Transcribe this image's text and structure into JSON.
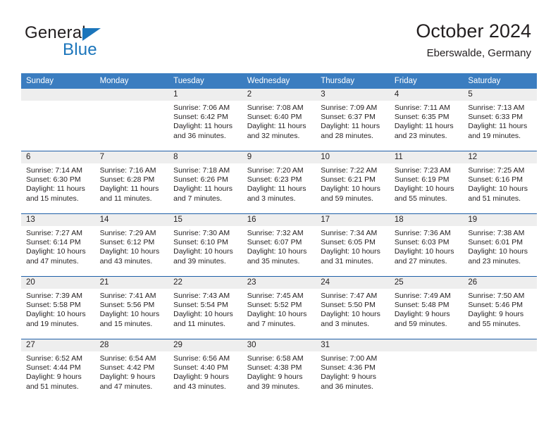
{
  "brand": {
    "word1": "General",
    "word2": "Blue",
    "logo_icon": "triangle-logo",
    "accent_color": "#1b75bb"
  },
  "header": {
    "title": "October 2024",
    "location": "Eberswalde, Germany"
  },
  "theme": {
    "header_blue": "#3b7dc0",
    "row_line_blue": "#1f5fa8",
    "daynum_band": "#eeeeee"
  },
  "calendar": {
    "weekday_headers": [
      "Sunday",
      "Monday",
      "Tuesday",
      "Wednesday",
      "Thursday",
      "Friday",
      "Saturday"
    ],
    "weeks": [
      [
        {
          "day": "",
          "sunrise": "",
          "sunset": "",
          "daylight1": "",
          "daylight2": ""
        },
        {
          "day": "",
          "sunrise": "",
          "sunset": "",
          "daylight1": "",
          "daylight2": ""
        },
        {
          "day": "1",
          "sunrise": "Sunrise: 7:06 AM",
          "sunset": "Sunset: 6:42 PM",
          "daylight1": "Daylight: 11 hours",
          "daylight2": "and 36 minutes."
        },
        {
          "day": "2",
          "sunrise": "Sunrise: 7:08 AM",
          "sunset": "Sunset: 6:40 PM",
          "daylight1": "Daylight: 11 hours",
          "daylight2": "and 32 minutes."
        },
        {
          "day": "3",
          "sunrise": "Sunrise: 7:09 AM",
          "sunset": "Sunset: 6:37 PM",
          "daylight1": "Daylight: 11 hours",
          "daylight2": "and 28 minutes."
        },
        {
          "day": "4",
          "sunrise": "Sunrise: 7:11 AM",
          "sunset": "Sunset: 6:35 PM",
          "daylight1": "Daylight: 11 hours",
          "daylight2": "and 23 minutes."
        },
        {
          "day": "5",
          "sunrise": "Sunrise: 7:13 AM",
          "sunset": "Sunset: 6:33 PM",
          "daylight1": "Daylight: 11 hours",
          "daylight2": "and 19 minutes."
        }
      ],
      [
        {
          "day": "6",
          "sunrise": "Sunrise: 7:14 AM",
          "sunset": "Sunset: 6:30 PM",
          "daylight1": "Daylight: 11 hours",
          "daylight2": "and 15 minutes."
        },
        {
          "day": "7",
          "sunrise": "Sunrise: 7:16 AM",
          "sunset": "Sunset: 6:28 PM",
          "daylight1": "Daylight: 11 hours",
          "daylight2": "and 11 minutes."
        },
        {
          "day": "8",
          "sunrise": "Sunrise: 7:18 AM",
          "sunset": "Sunset: 6:26 PM",
          "daylight1": "Daylight: 11 hours",
          "daylight2": "and 7 minutes."
        },
        {
          "day": "9",
          "sunrise": "Sunrise: 7:20 AM",
          "sunset": "Sunset: 6:23 PM",
          "daylight1": "Daylight: 11 hours",
          "daylight2": "and 3 minutes."
        },
        {
          "day": "10",
          "sunrise": "Sunrise: 7:22 AM",
          "sunset": "Sunset: 6:21 PM",
          "daylight1": "Daylight: 10 hours",
          "daylight2": "and 59 minutes."
        },
        {
          "day": "11",
          "sunrise": "Sunrise: 7:23 AM",
          "sunset": "Sunset: 6:19 PM",
          "daylight1": "Daylight: 10 hours",
          "daylight2": "and 55 minutes."
        },
        {
          "day": "12",
          "sunrise": "Sunrise: 7:25 AM",
          "sunset": "Sunset: 6:16 PM",
          "daylight1": "Daylight: 10 hours",
          "daylight2": "and 51 minutes."
        }
      ],
      [
        {
          "day": "13",
          "sunrise": "Sunrise: 7:27 AM",
          "sunset": "Sunset: 6:14 PM",
          "daylight1": "Daylight: 10 hours",
          "daylight2": "and 47 minutes."
        },
        {
          "day": "14",
          "sunrise": "Sunrise: 7:29 AM",
          "sunset": "Sunset: 6:12 PM",
          "daylight1": "Daylight: 10 hours",
          "daylight2": "and 43 minutes."
        },
        {
          "day": "15",
          "sunrise": "Sunrise: 7:30 AM",
          "sunset": "Sunset: 6:10 PM",
          "daylight1": "Daylight: 10 hours",
          "daylight2": "and 39 minutes."
        },
        {
          "day": "16",
          "sunrise": "Sunrise: 7:32 AM",
          "sunset": "Sunset: 6:07 PM",
          "daylight1": "Daylight: 10 hours",
          "daylight2": "and 35 minutes."
        },
        {
          "day": "17",
          "sunrise": "Sunrise: 7:34 AM",
          "sunset": "Sunset: 6:05 PM",
          "daylight1": "Daylight: 10 hours",
          "daylight2": "and 31 minutes."
        },
        {
          "day": "18",
          "sunrise": "Sunrise: 7:36 AM",
          "sunset": "Sunset: 6:03 PM",
          "daylight1": "Daylight: 10 hours",
          "daylight2": "and 27 minutes."
        },
        {
          "day": "19",
          "sunrise": "Sunrise: 7:38 AM",
          "sunset": "Sunset: 6:01 PM",
          "daylight1": "Daylight: 10 hours",
          "daylight2": "and 23 minutes."
        }
      ],
      [
        {
          "day": "20",
          "sunrise": "Sunrise: 7:39 AM",
          "sunset": "Sunset: 5:58 PM",
          "daylight1": "Daylight: 10 hours",
          "daylight2": "and 19 minutes."
        },
        {
          "day": "21",
          "sunrise": "Sunrise: 7:41 AM",
          "sunset": "Sunset: 5:56 PM",
          "daylight1": "Daylight: 10 hours",
          "daylight2": "and 15 minutes."
        },
        {
          "day": "22",
          "sunrise": "Sunrise: 7:43 AM",
          "sunset": "Sunset: 5:54 PM",
          "daylight1": "Daylight: 10 hours",
          "daylight2": "and 11 minutes."
        },
        {
          "day": "23",
          "sunrise": "Sunrise: 7:45 AM",
          "sunset": "Sunset: 5:52 PM",
          "daylight1": "Daylight: 10 hours",
          "daylight2": "and 7 minutes."
        },
        {
          "day": "24",
          "sunrise": "Sunrise: 7:47 AM",
          "sunset": "Sunset: 5:50 PM",
          "daylight1": "Daylight: 10 hours",
          "daylight2": "and 3 minutes."
        },
        {
          "day": "25",
          "sunrise": "Sunrise: 7:49 AM",
          "sunset": "Sunset: 5:48 PM",
          "daylight1": "Daylight: 9 hours",
          "daylight2": "and 59 minutes."
        },
        {
          "day": "26",
          "sunrise": "Sunrise: 7:50 AM",
          "sunset": "Sunset: 5:46 PM",
          "daylight1": "Daylight: 9 hours",
          "daylight2": "and 55 minutes."
        }
      ],
      [
        {
          "day": "27",
          "sunrise": "Sunrise: 6:52 AM",
          "sunset": "Sunset: 4:44 PM",
          "daylight1": "Daylight: 9 hours",
          "daylight2": "and 51 minutes."
        },
        {
          "day": "28",
          "sunrise": "Sunrise: 6:54 AM",
          "sunset": "Sunset: 4:42 PM",
          "daylight1": "Daylight: 9 hours",
          "daylight2": "and 47 minutes."
        },
        {
          "day": "29",
          "sunrise": "Sunrise: 6:56 AM",
          "sunset": "Sunset: 4:40 PM",
          "daylight1": "Daylight: 9 hours",
          "daylight2": "and 43 minutes."
        },
        {
          "day": "30",
          "sunrise": "Sunrise: 6:58 AM",
          "sunset": "Sunset: 4:38 PM",
          "daylight1": "Daylight: 9 hours",
          "daylight2": "and 39 minutes."
        },
        {
          "day": "31",
          "sunrise": "Sunrise: 7:00 AM",
          "sunset": "Sunset: 4:36 PM",
          "daylight1": "Daylight: 9 hours",
          "daylight2": "and 36 minutes."
        },
        {
          "day": "",
          "sunrise": "",
          "sunset": "",
          "daylight1": "",
          "daylight2": ""
        },
        {
          "day": "",
          "sunrise": "",
          "sunset": "",
          "daylight1": "",
          "daylight2": ""
        }
      ]
    ]
  }
}
